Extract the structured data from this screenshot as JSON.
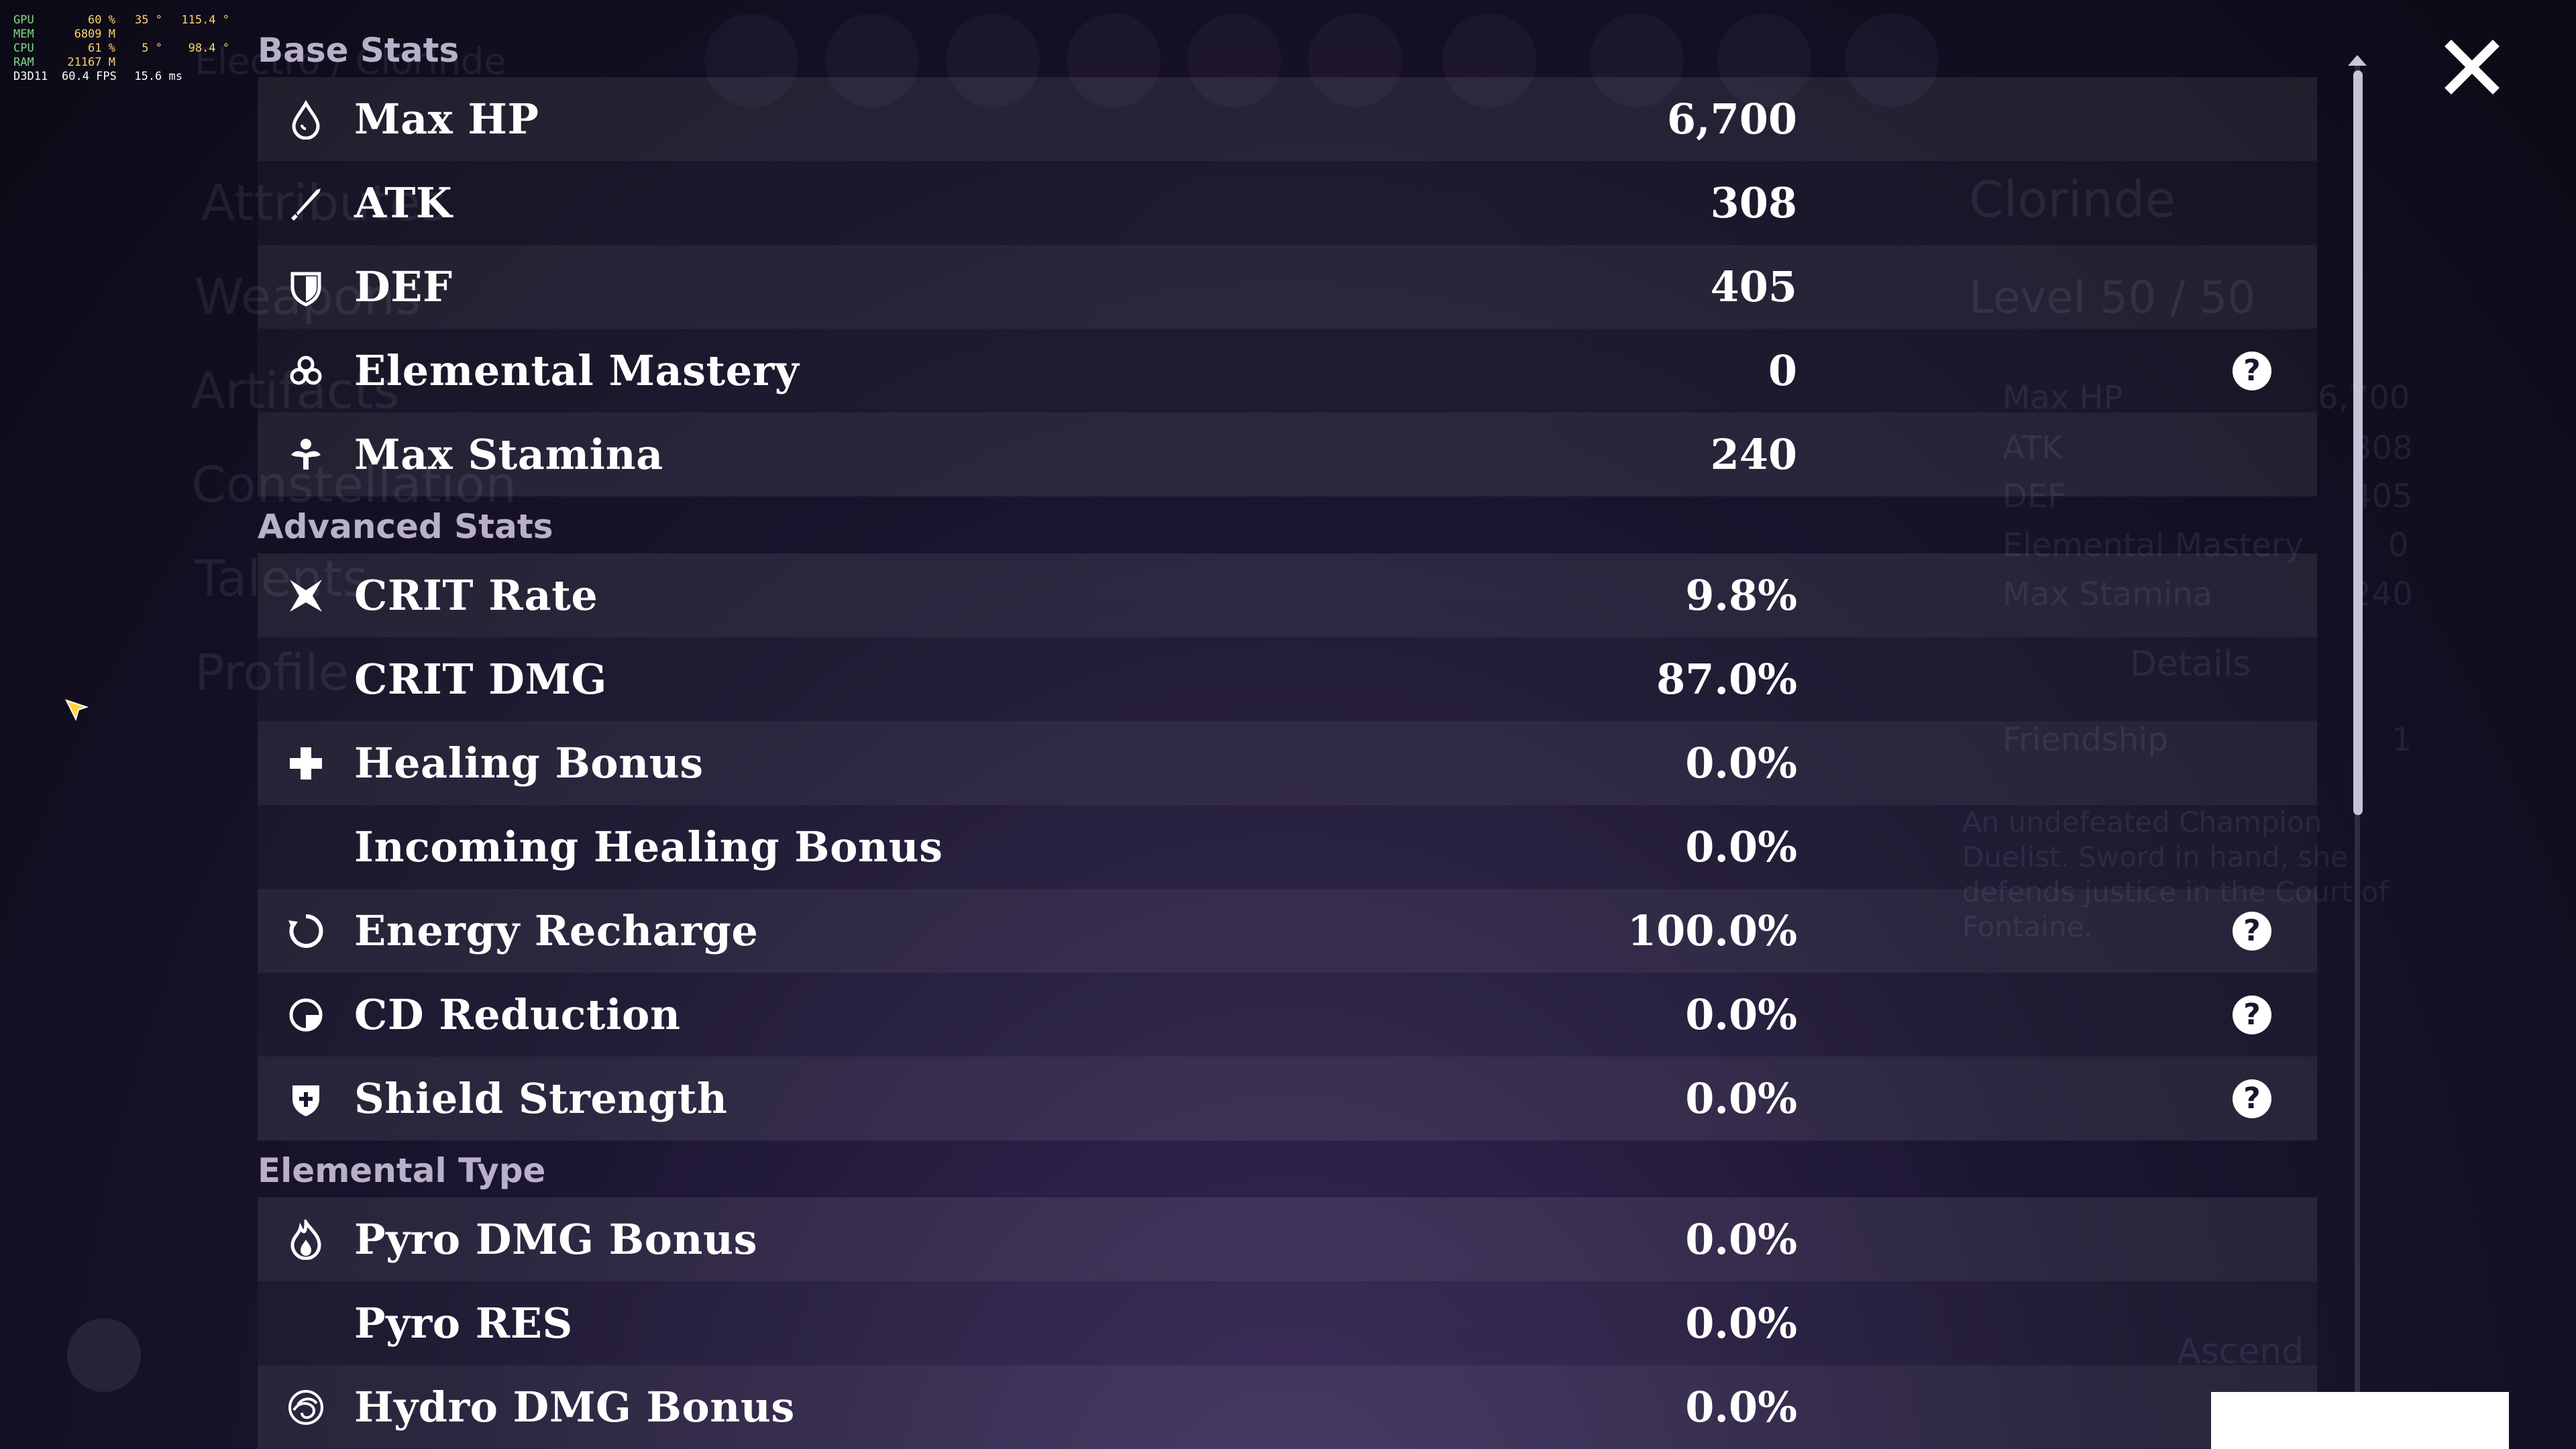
{
  "hud": [
    {
      "key": "GPU",
      "v1": "60 %",
      "v2": "35 °",
      "v3": "115.4 °"
    },
    {
      "key": "MEM",
      "v1": "6809 M",
      "v2": "",
      "v3": ""
    },
    {
      "key": "CPU",
      "v1": "61 %",
      "v2": "5 °",
      "v3": "98.4 °"
    },
    {
      "key": "RAM",
      "v1": "21167 M",
      "v2": "",
      "v3": ""
    },
    {
      "key": "D3D11",
      "v1": "60.4 FPS",
      "v2": "15.6 ms",
      "v3": ""
    }
  ],
  "background": {
    "header": "Electro / Clorinde",
    "menu": [
      "Attributes",
      "Weapons",
      "Artifacts",
      "Constellation",
      "Talents",
      "Profile"
    ],
    "name": "Clorinde",
    "level": "Level 50 / 50",
    "stats": [
      {
        "label": "Max HP",
        "value": "6,700"
      },
      {
        "label": "ATK",
        "value": "308"
      },
      {
        "label": "DEF",
        "value": "405"
      },
      {
        "label": "Elemental Mastery",
        "value": "0"
      },
      {
        "label": "Max Stamina",
        "value": "240"
      }
    ],
    "details": "Details",
    "friendship": "Friendship",
    "friendship_value": "1",
    "description": "An undefeated Champion Duelist. Sword in hand, she defends justice in the Court of Fontaine.",
    "ascend": "Ascend"
  },
  "sections": {
    "base": "Base Stats",
    "advanced": "Advanced Stats",
    "elemental": "Elemental Type"
  },
  "base_stats": [
    {
      "label": "Max HP",
      "value": "6,700",
      "icon": "hp-drop-icon",
      "help": false
    },
    {
      "label": "ATK",
      "value": "308",
      "icon": "sword-icon",
      "help": false
    },
    {
      "label": "DEF",
      "value": "405",
      "icon": "shield-icon",
      "help": false
    },
    {
      "label": "Elemental Mastery",
      "value": "0",
      "icon": "mastery-icon",
      "help": true
    },
    {
      "label": "Max Stamina",
      "value": "240",
      "icon": "stamina-icon",
      "help": false
    }
  ],
  "advanced_stats": [
    {
      "label": "CRIT Rate",
      "value": "9.8%",
      "icon": "crit-icon",
      "help": false
    },
    {
      "label": "CRIT DMG",
      "value": "87.0%",
      "icon": "",
      "help": false
    },
    {
      "label": "Healing Bonus",
      "value": "0.0%",
      "icon": "plus-icon",
      "help": false
    },
    {
      "label": "Incoming Healing Bonus",
      "value": "0.0%",
      "icon": "",
      "help": false
    },
    {
      "label": "Energy Recharge",
      "value": "100.0%",
      "icon": "energy-icon",
      "help": true
    },
    {
      "label": "CD Reduction",
      "value": "0.0%",
      "icon": "cd-icon",
      "help": true
    },
    {
      "label": "Shield Strength",
      "value": "0.0%",
      "icon": "shield-strength-icon",
      "help": true
    }
  ],
  "elemental_stats": [
    {
      "label": "Pyro DMG Bonus",
      "value": "0.0%",
      "icon": "pyro-icon",
      "help": false
    },
    {
      "label": "Pyro RES",
      "value": "0.0%",
      "icon": "",
      "help": false
    },
    {
      "label": "Hydro DMG Bonus",
      "value": "0.0%",
      "icon": "hydro-icon",
      "help": false
    }
  ],
  "help_glyph": "?"
}
